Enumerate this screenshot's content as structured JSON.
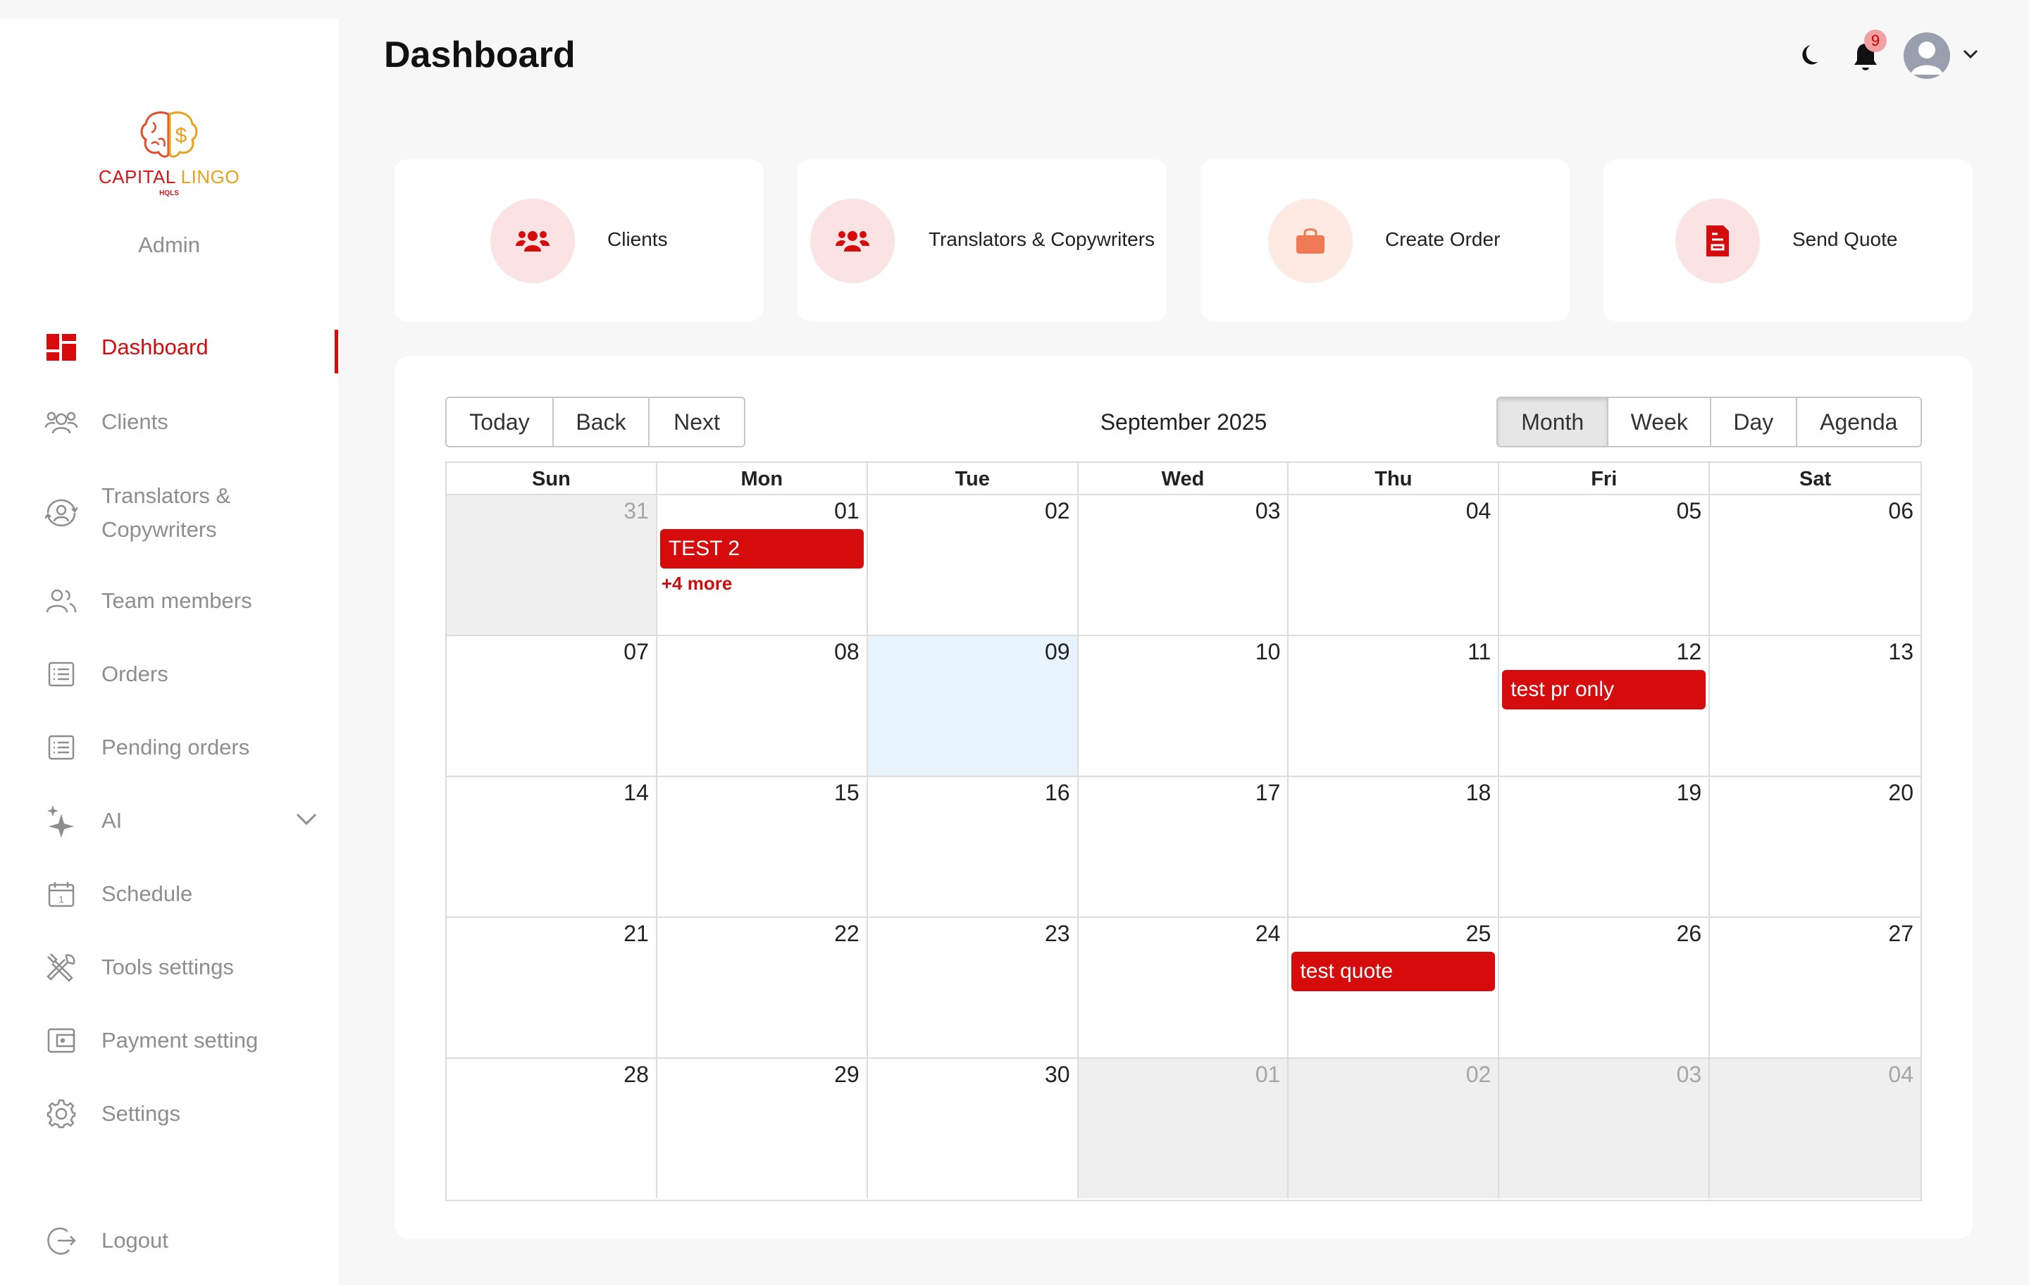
{
  "page": {
    "title": "Dashboard"
  },
  "brand": {
    "name_part1": "CAPITAL",
    "name_part2": "LINGO",
    "sub": "HQLS",
    "role": "Admin"
  },
  "sidebar": {
    "items": [
      {
        "label": "Dashboard",
        "icon": "dashboard-icon",
        "active": true
      },
      {
        "label": "Clients",
        "icon": "users-icon"
      },
      {
        "label": "Translators & Copywriters",
        "icon": "user-sync-icon"
      },
      {
        "label": "Team members",
        "icon": "team-icon"
      },
      {
        "label": "Orders",
        "icon": "list-icon"
      },
      {
        "label": "Pending orders",
        "icon": "list-icon"
      },
      {
        "label": "AI",
        "icon": "sparkle-icon"
      },
      {
        "label": "Schedule",
        "icon": "calendar-icon"
      },
      {
        "label": "Tools settings",
        "icon": "tools-icon"
      },
      {
        "label": "Payment setting",
        "icon": "wallet-icon"
      },
      {
        "label": "Settings",
        "icon": "gear-icon"
      }
    ],
    "logout": "Logout"
  },
  "header": {
    "notification_count": "9"
  },
  "quick_actions": [
    {
      "label": "Clients",
      "icon": "users-icon"
    },
    {
      "label": "Translators & Copywriters",
      "icon": "users-icon"
    },
    {
      "label": "Create Order",
      "icon": "shopping-bag-icon"
    },
    {
      "label": "Send Quote",
      "icon": "document-icon"
    }
  ],
  "calendar": {
    "nav_buttons": [
      "Today",
      "Back",
      "Next"
    ],
    "month_label": "September 2025",
    "view_buttons": [
      "Month",
      "Week",
      "Day",
      "Agenda"
    ],
    "active_view": "Month",
    "days_of_week": [
      "Sun",
      "Mon",
      "Tue",
      "Wed",
      "Thu",
      "Fri",
      "Sat"
    ],
    "weeks": [
      [
        "31",
        "01",
        "02",
        "03",
        "04",
        "05",
        "06"
      ],
      [
        "07",
        "08",
        "09",
        "10",
        "11",
        "12",
        "13"
      ],
      [
        "14",
        "15",
        "16",
        "17",
        "18",
        "19",
        "20"
      ],
      [
        "21",
        "22",
        "23",
        "24",
        "25",
        "26",
        "27"
      ],
      [
        "28",
        "29",
        "30",
        "01",
        "02",
        "03",
        "04"
      ]
    ],
    "events": {
      "test2": "TEST 2",
      "test2_more": "+4 more",
      "pr_only": "test pr only",
      "quote": "test quote"
    }
  },
  "colors": {
    "accent": "#d60b0b",
    "today": "#e8f4fd",
    "off_month": "#efefef"
  }
}
